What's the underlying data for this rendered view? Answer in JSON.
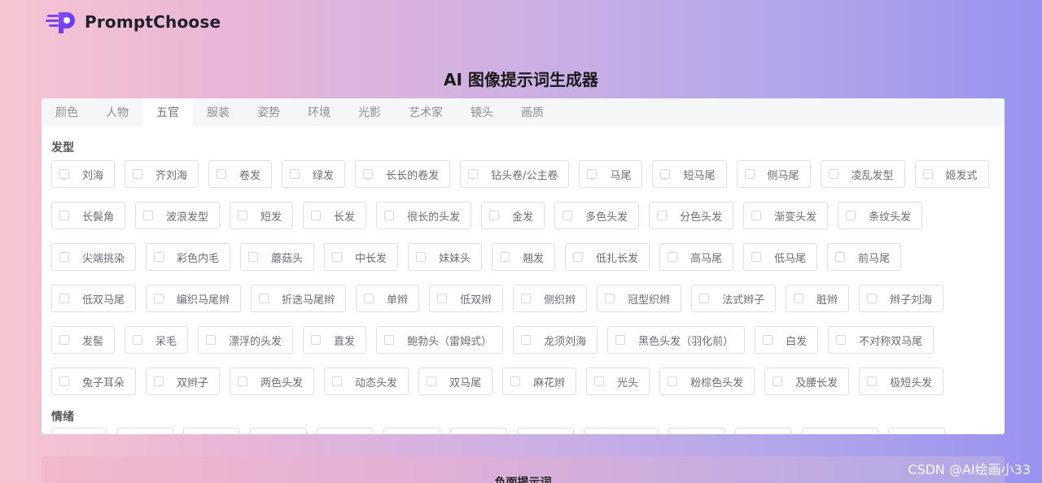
{
  "brand": {
    "name": "PromptChoose"
  },
  "page_title": "AI 图像提示词生成器",
  "tabs": [
    {
      "label": "颜色",
      "active": false
    },
    {
      "label": "人物",
      "active": false
    },
    {
      "label": "五官",
      "active": true
    },
    {
      "label": "服装",
      "active": false
    },
    {
      "label": "姿势",
      "active": false
    },
    {
      "label": "环境",
      "active": false
    },
    {
      "label": "光影",
      "active": false
    },
    {
      "label": "艺术家",
      "active": false
    },
    {
      "label": "镜头",
      "active": false
    },
    {
      "label": "画质",
      "active": false
    }
  ],
  "sections": {
    "hair": {
      "title": "发型",
      "options": [
        "刘海",
        "齐刘海",
        "卷发",
        "绿发",
        "长长的卷发",
        "钻头卷/公主卷",
        "马尾",
        "短马尾",
        "侧马尾",
        "凌乱发型",
        "姬发式",
        "长鬓角",
        "波浪发型",
        "短发",
        "长发",
        "很长的头发",
        "金发",
        "多色头发",
        "分色头发",
        "渐变头发",
        "条纹头发",
        "尖端挑染",
        "彩色内毛",
        "蘑菇头",
        "中长发",
        "妹妹头",
        "翘发",
        "低扎长发",
        "高马尾",
        "低马尾",
        "前马尾",
        "低双马尾",
        "编织马尾辫",
        "折迭马尾辫",
        "单辫",
        "低双辫",
        "侧织辫",
        "冠型织辫",
        "法式辫子",
        "脏辫",
        "辫子刘海",
        "发髻",
        "呆毛",
        "漂浮的头发",
        "直发",
        "鲍勃头（雷姆式）",
        "龙须刘海",
        "黑色头发（羽化前）",
        "白发",
        "不对称双马尾",
        "兔子耳朵",
        "双辫子",
        "两色头发",
        "动态头发",
        "双马尾",
        "麻花辫",
        "光头",
        "粉棕色头发",
        "及腰长发",
        "极短头发"
      ]
    },
    "emotion": {
      "title": "情绪",
      "visible_chip_count": 13
    }
  },
  "negative_prompt": {
    "title": "负面提示词"
  },
  "watermark": "CSDN @AI绘画小33",
  "colors": {
    "logo_purple": "#6a3df0",
    "chip_border": "#dcdfe6",
    "tab_bar_bg": "#f5f6f8"
  }
}
